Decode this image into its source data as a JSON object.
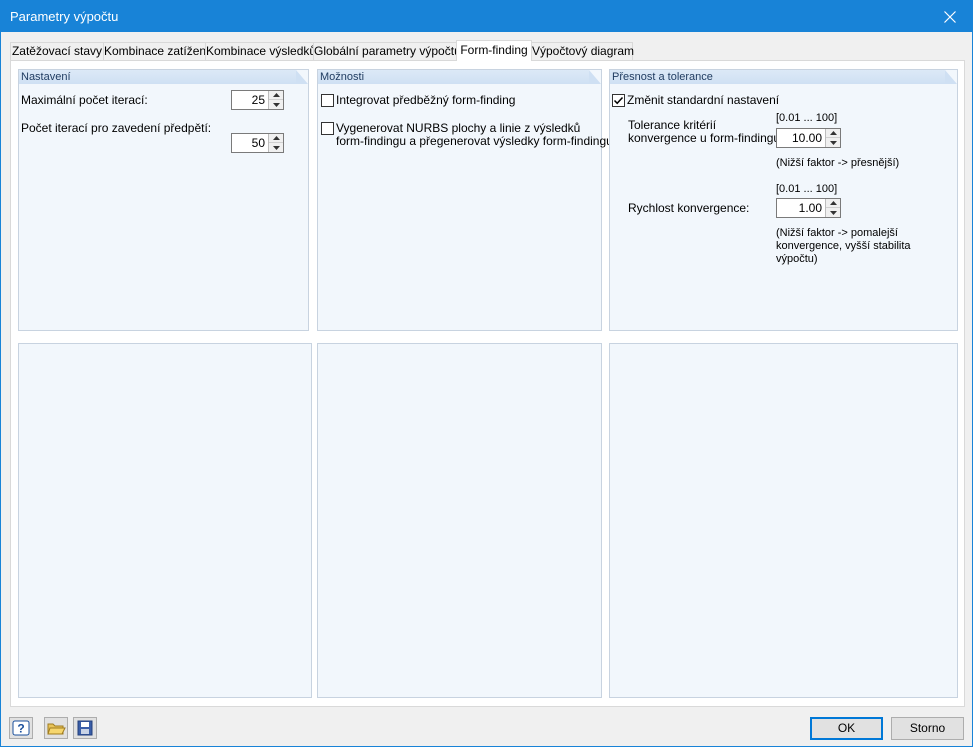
{
  "window": {
    "title": "Parametry výpočtu"
  },
  "tabs": [
    {
      "label": "Zatěžovací stavy"
    },
    {
      "label": "Kombinace zatížení"
    },
    {
      "label": "Kombinace výsledků"
    },
    {
      "label": "Globální parametry výpočtu"
    },
    {
      "label": "Form-finding"
    },
    {
      "label": "Výpočtový diagram"
    }
  ],
  "settings": {
    "header": "Nastavení",
    "max_iter": {
      "label": "Maximální počet iterací:",
      "value": "25"
    },
    "prestress_iter": {
      "label": "Počet iterací pro zavedení předpětí:",
      "value": "50"
    }
  },
  "options": {
    "header": "Možnosti",
    "integrate": {
      "label": "Integrovat předběžný form-finding",
      "checked": false
    },
    "nurbs": {
      "line1": "Vygenerovat NURBS plochy a linie z výsledků",
      "line2": "form-findingu a přegenerovat výsledky form-findingu",
      "checked": false
    }
  },
  "precision": {
    "header": "Přesnost a tolerance",
    "change_defaults": {
      "label": "Změnit standardní nastavení",
      "checked": true
    },
    "tolerance": {
      "label1": "Tolerance kritérií",
      "label2": "konvergence u form-findingu:",
      "range": "[0.01 ... 100]",
      "value": "10.00",
      "hint": "(Nižší faktor -> přesnější)"
    },
    "speed": {
      "label": "Rychlost konvergence:",
      "range": "[0.01 ... 100]",
      "value": "1.00",
      "hint1": "(Nižší faktor -> pomalejší",
      "hint2": "konvergence, vyšší stabilita",
      "hint3": "výpočtu)"
    }
  },
  "footer": {
    "ok": "OK",
    "cancel": "Storno"
  },
  "icons": {
    "help": "help-icon",
    "open": "folder-open-icon",
    "save": "save-icon"
  }
}
